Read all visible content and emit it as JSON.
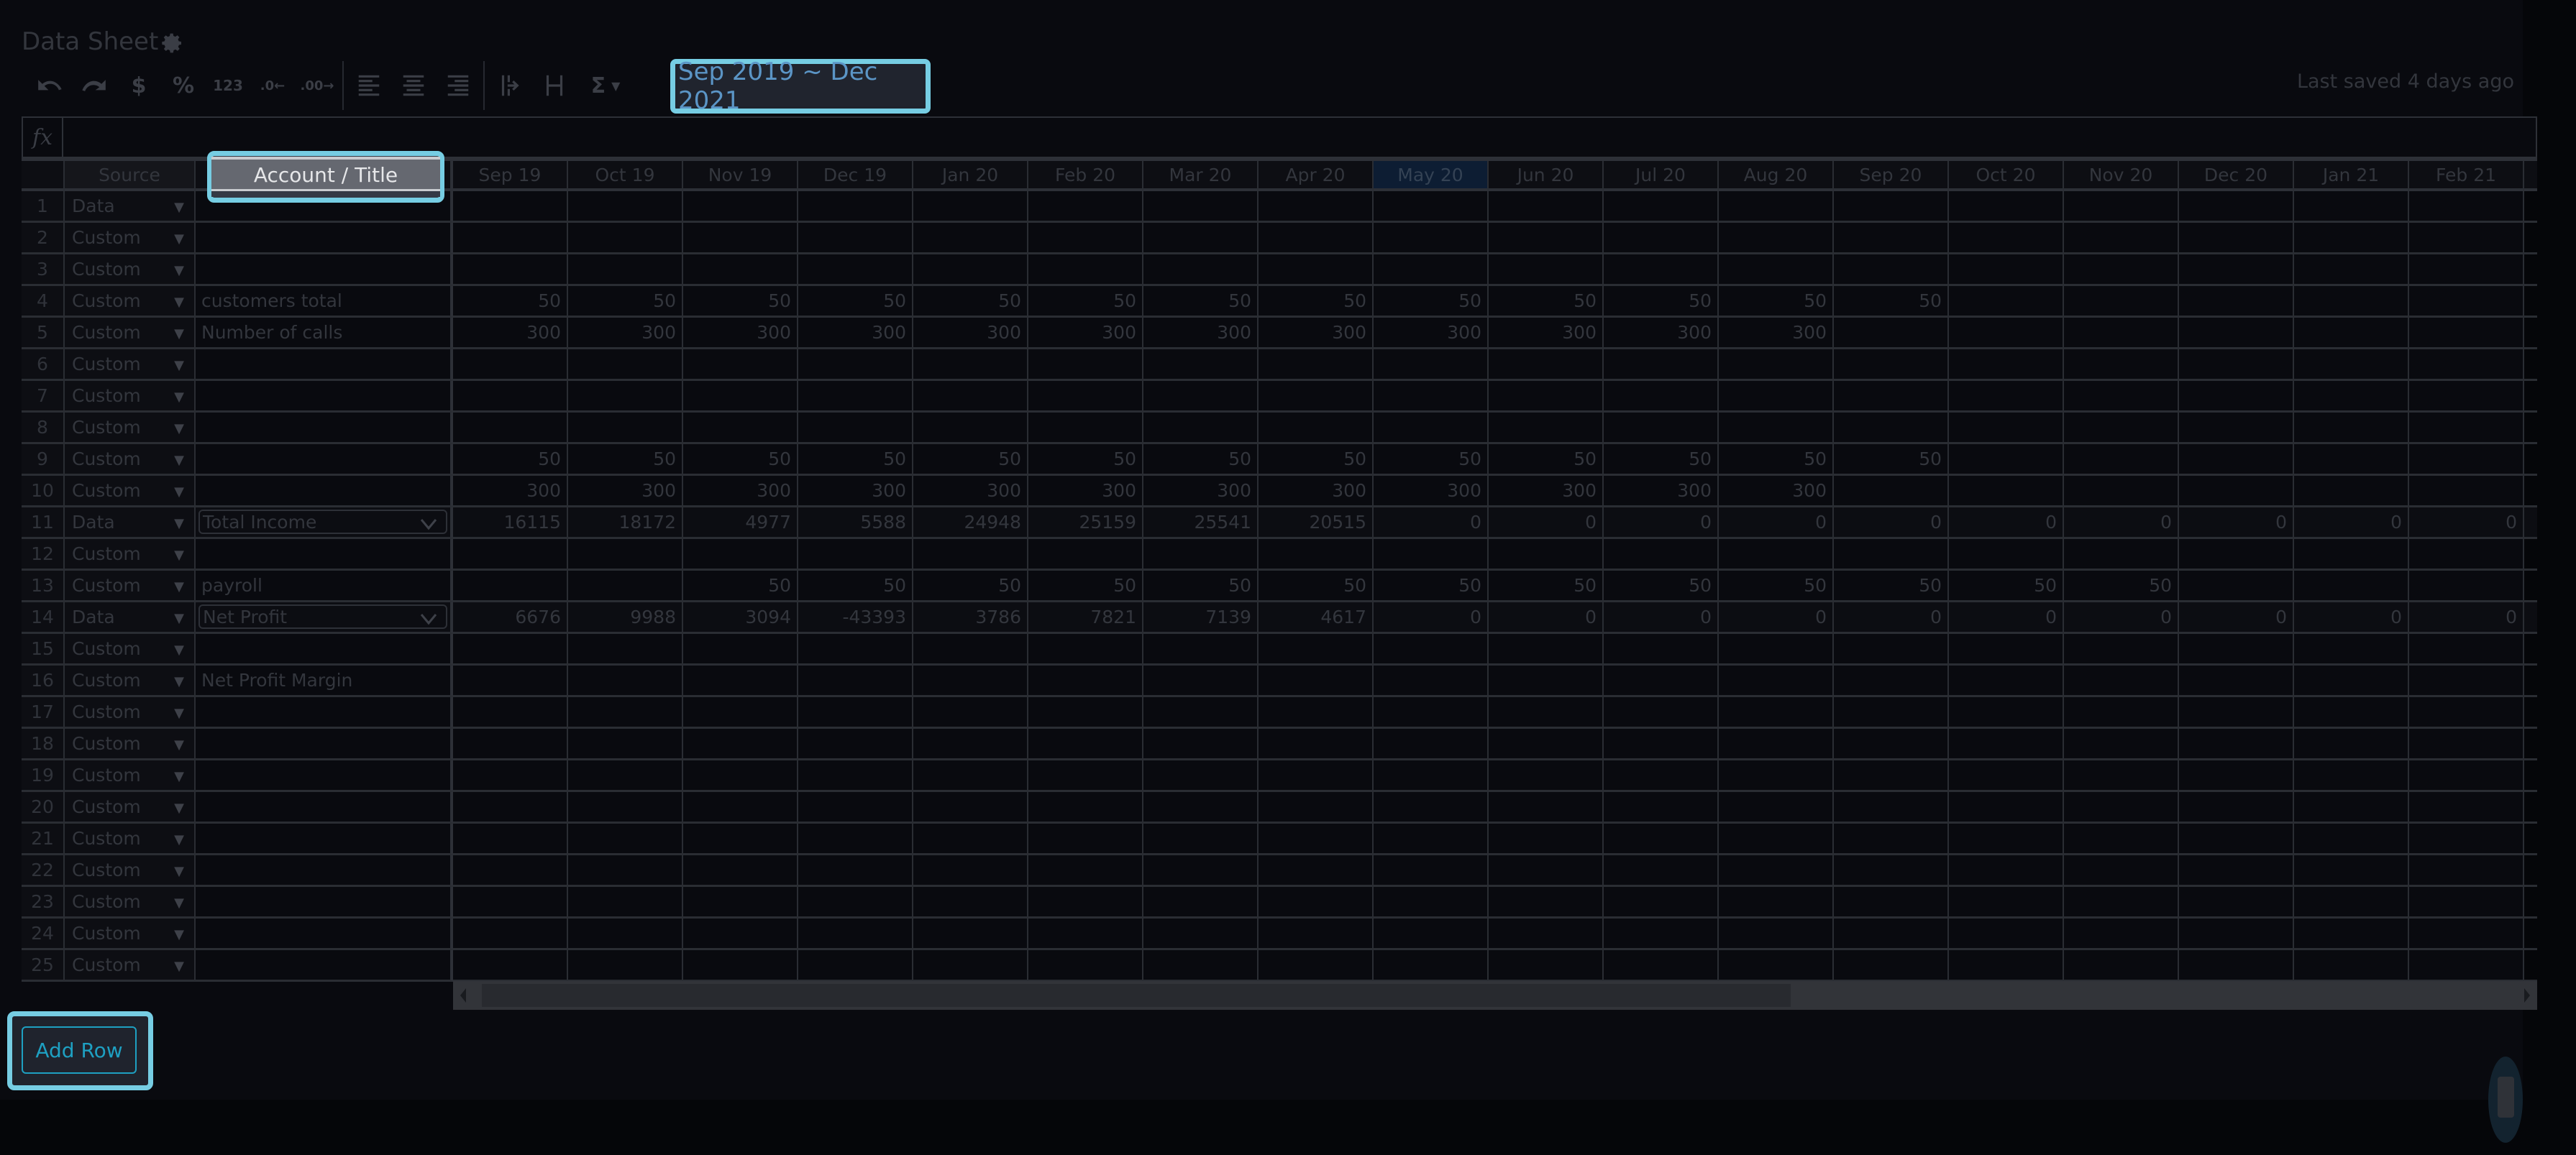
{
  "header": {
    "title": "Data Sheet",
    "last_saved": "Last saved 4 days ago",
    "date_range": "Sep 2019 ~ Dec 2021"
  },
  "toolbar": {
    "items": [
      {
        "name": "undo",
        "glyph": "↶"
      },
      {
        "name": "redo",
        "glyph": "↷"
      },
      {
        "name": "currency",
        "glyph": "$"
      },
      {
        "name": "percent",
        "glyph": "%"
      },
      {
        "name": "number-format",
        "glyph": "123"
      },
      {
        "name": "decrease-decimal",
        "glyph": ".0←"
      },
      {
        "name": "increase-decimal",
        "glyph": ".00→"
      },
      {
        "name": "align-left",
        "glyph": "≡"
      },
      {
        "name": "align-center",
        "glyph": "≡"
      },
      {
        "name": "align-right",
        "glyph": "≡"
      },
      {
        "name": "insert-column",
        "glyph": "|→"
      },
      {
        "name": "column-width",
        "glyph": "|-|"
      },
      {
        "name": "sum",
        "glyph": "Σ"
      }
    ]
  },
  "formula_bar": {
    "label": "fx",
    "value": ""
  },
  "grid": {
    "headers": {
      "source": "Source",
      "title": "Account / Title",
      "months": [
        "Sep 19",
        "Oct 19",
        "Nov 19",
        "Dec 19",
        "Jan 20",
        "Feb 20",
        "Mar 20",
        "Apr 20",
        "May 20",
        "Jun 20",
        "Jul 20",
        "Aug 20",
        "Sep 20",
        "Oct 20",
        "Nov 20",
        "Dec 20",
        "Jan 21",
        "Feb 21",
        ""
      ],
      "selected_month": "May 20"
    },
    "rows": [
      {
        "num": "1",
        "source": "Data",
        "title": "",
        "dropdown": false,
        "values": []
      },
      {
        "num": "2",
        "source": "Custom",
        "title": "",
        "dropdown": false,
        "values": []
      },
      {
        "num": "3",
        "source": "Custom",
        "title": "",
        "dropdown": false,
        "values": []
      },
      {
        "num": "4",
        "source": "Custom",
        "title": "customers total",
        "dropdown": false,
        "values": [
          "50",
          "50",
          "50",
          "50",
          "50",
          "50",
          "50",
          "50",
          "50",
          "50",
          "50",
          "50",
          "50"
        ]
      },
      {
        "num": "5",
        "source": "Custom",
        "title": "Number of calls",
        "dropdown": false,
        "values": [
          "300",
          "300",
          "300",
          "300",
          "300",
          "300",
          "300",
          "300",
          "300",
          "300",
          "300",
          "300"
        ]
      },
      {
        "num": "6",
        "source": "Custom",
        "title": "",
        "dropdown": false,
        "values": []
      },
      {
        "num": "7",
        "source": "Custom",
        "title": "",
        "dropdown": false,
        "values": []
      },
      {
        "num": "8",
        "source": "Custom",
        "title": "",
        "dropdown": false,
        "values": []
      },
      {
        "num": "9",
        "source": "Custom",
        "title": "",
        "dropdown": false,
        "values": [
          "50",
          "50",
          "50",
          "50",
          "50",
          "50",
          "50",
          "50",
          "50",
          "50",
          "50",
          "50",
          "50"
        ]
      },
      {
        "num": "10",
        "source": "Custom",
        "title": "",
        "dropdown": false,
        "values": [
          "300",
          "300",
          "300",
          "300",
          "300",
          "300",
          "300",
          "300",
          "300",
          "300",
          "300",
          "300"
        ]
      },
      {
        "num": "11",
        "source": "Data",
        "title": "Total Income",
        "dropdown": true,
        "values": [
          "16115",
          "18172",
          "4977",
          "5588",
          "24948",
          "25159",
          "25541",
          "20515",
          "0",
          "0",
          "0",
          "0",
          "0",
          "0",
          "0",
          "0",
          "0",
          "0"
        ]
      },
      {
        "num": "12",
        "source": "Custom",
        "title": "",
        "dropdown": false,
        "values": []
      },
      {
        "num": "13",
        "source": "Custom",
        "title": "payroll",
        "dropdown": false,
        "values": [
          "",
          "",
          "50",
          "50",
          "50",
          "50",
          "50",
          "50",
          "50",
          "50",
          "50",
          "50",
          "50",
          "50",
          "50"
        ]
      },
      {
        "num": "14",
        "source": "Data",
        "title": "Net Profit",
        "dropdown": true,
        "values": [
          "6676",
          "9988",
          "3094",
          "-43393",
          "3786",
          "7821",
          "7139",
          "4617",
          "0",
          "0",
          "0",
          "0",
          "0",
          "0",
          "0",
          "0",
          "0",
          "0"
        ]
      },
      {
        "num": "15",
        "source": "Custom",
        "title": "",
        "dropdown": false,
        "values": []
      },
      {
        "num": "16",
        "source": "Custom",
        "title": "Net Profit Margin",
        "dropdown": false,
        "values": []
      },
      {
        "num": "17",
        "source": "Custom",
        "title": "",
        "dropdown": false,
        "values": []
      },
      {
        "num": "18",
        "source": "Custom",
        "title": "",
        "dropdown": false,
        "values": []
      },
      {
        "num": "19",
        "source": "Custom",
        "title": "",
        "dropdown": false,
        "values": []
      },
      {
        "num": "20",
        "source": "Custom",
        "title": "",
        "dropdown": false,
        "values": []
      },
      {
        "num": "21",
        "source": "Custom",
        "title": "",
        "dropdown": false,
        "values": []
      },
      {
        "num": "22",
        "source": "Custom",
        "title": "",
        "dropdown": false,
        "values": []
      },
      {
        "num": "23",
        "source": "Custom",
        "title": "",
        "dropdown": false,
        "values": []
      },
      {
        "num": "24",
        "source": "Custom",
        "title": "",
        "dropdown": false,
        "values": []
      },
      {
        "num": "25",
        "source": "Custom",
        "title": "",
        "dropdown": false,
        "values": []
      }
    ]
  },
  "footer": {
    "add_row_label": "Add Row"
  },
  "colors": {
    "highlight": "#76cde3",
    "date_text": "#5b95c6",
    "add_row": "#1ea0c2",
    "selected_header": "#0d1d33"
  }
}
